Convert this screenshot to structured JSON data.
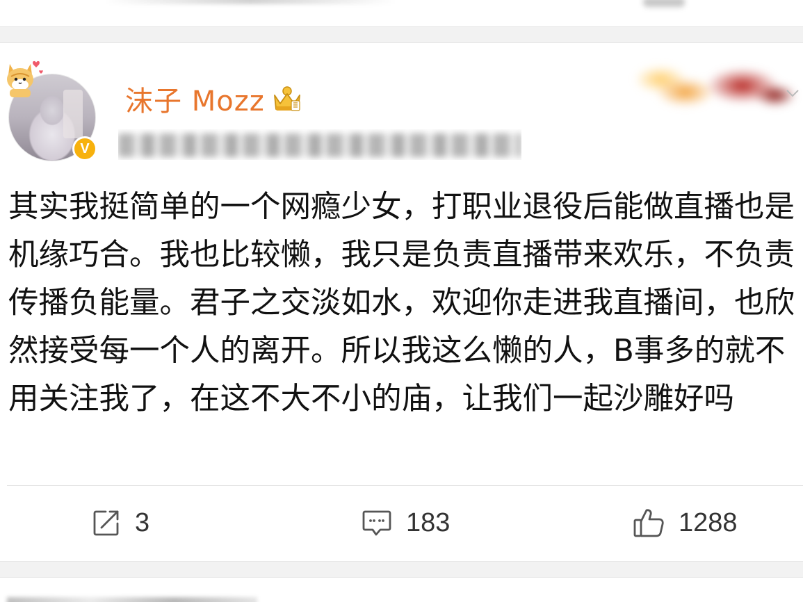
{
  "post": {
    "author": {
      "name": "沫子 Mozz",
      "verified_badge": "V",
      "avatar_icon": "avatar-photo",
      "member_icon": "crown-icon",
      "sticker_icon": "cat-sticker-icon"
    },
    "text": "其实我挺简单的一个网瘾少女，打职业退役后能做直播也是机缘巧合。我也比较懒，我只是负责直播带来欢乐，不负责传播负能量。君子之交淡如水，欢迎你走进我直播间，也欣然接受每一个人的离开。所以我这么懒的人，B事多的就不用关注我了，在这不大不小的庙，让我们一起沙雕好吗",
    "actions": {
      "repost_count": "3",
      "comment_count": "183",
      "like_count": "1288"
    }
  },
  "colors": {
    "username": "#e8762d",
    "verified_badge": "#f7b10d",
    "text": "#111111",
    "action_text": "#333333",
    "separator_gap": "#f2f2f2"
  }
}
